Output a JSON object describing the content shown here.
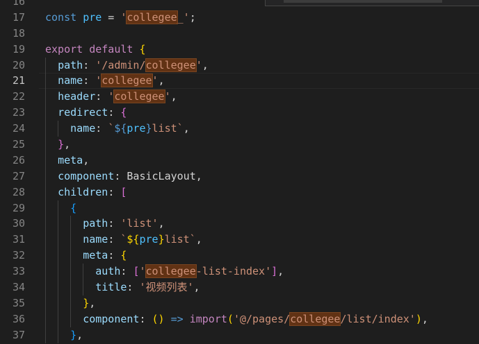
{
  "editor": {
    "lines": [
      {
        "num": "16",
        "indent": 0,
        "tokens": []
      },
      {
        "num": "17",
        "indent": 0,
        "tokens": [
          {
            "t": "const",
            "c": "kw"
          },
          {
            "t": " ",
            "c": "punc"
          },
          {
            "t": "pre",
            "c": "var"
          },
          {
            "t": " = ",
            "c": "punc"
          },
          {
            "t": "'",
            "c": "str"
          },
          {
            "t": "collegee",
            "c": "str",
            "hl": true
          },
          {
            "t": "_'",
            "c": "str"
          },
          {
            "t": ";",
            "c": "punc"
          }
        ]
      },
      {
        "num": "18",
        "indent": 0,
        "tokens": []
      },
      {
        "num": "19",
        "indent": 0,
        "tokens": [
          {
            "t": "export",
            "c": "ctl"
          },
          {
            "t": " ",
            "c": "punc"
          },
          {
            "t": "default",
            "c": "ctl"
          },
          {
            "t": " ",
            "c": "punc"
          },
          {
            "t": "{",
            "c": "b1"
          }
        ]
      },
      {
        "num": "20",
        "indent": 1,
        "tokens": [
          {
            "t": "  ",
            "c": "punc"
          },
          {
            "t": "path",
            "c": "prop"
          },
          {
            "t": ": ",
            "c": "punc"
          },
          {
            "t": "'/admin/",
            "c": "str"
          },
          {
            "t": "collegee",
            "c": "str",
            "hl": true
          },
          {
            "t": "'",
            "c": "str"
          },
          {
            "t": ",",
            "c": "punc"
          }
        ]
      },
      {
        "num": "21",
        "indent": 1,
        "current": true,
        "tokens": [
          {
            "t": "  ",
            "c": "punc"
          },
          {
            "t": "name",
            "c": "prop"
          },
          {
            "t": ": ",
            "c": "punc"
          },
          {
            "t": "'",
            "c": "str"
          },
          {
            "t": "collegee",
            "c": "str",
            "hl": true
          },
          {
            "t": "'",
            "c": "str"
          },
          {
            "t": ",",
            "c": "punc"
          }
        ]
      },
      {
        "num": "22",
        "indent": 1,
        "tokens": [
          {
            "t": "  ",
            "c": "punc"
          },
          {
            "t": "header",
            "c": "prop"
          },
          {
            "t": ": ",
            "c": "punc"
          },
          {
            "t": "'",
            "c": "str"
          },
          {
            "t": "collegee",
            "c": "str",
            "hl": true
          },
          {
            "t": "'",
            "c": "str"
          },
          {
            "t": ",",
            "c": "punc"
          }
        ]
      },
      {
        "num": "23",
        "indent": 1,
        "tokens": [
          {
            "t": "  ",
            "c": "punc"
          },
          {
            "t": "redirect",
            "c": "prop"
          },
          {
            "t": ": ",
            "c": "punc"
          },
          {
            "t": "{",
            "c": "b2"
          }
        ]
      },
      {
        "num": "24",
        "indent": 2,
        "tokens": [
          {
            "t": "    ",
            "c": "punc"
          },
          {
            "t": "name",
            "c": "prop"
          },
          {
            "t": ": ",
            "c": "punc"
          },
          {
            "t": "`",
            "c": "str"
          },
          {
            "t": "${",
            "c": "tpl"
          },
          {
            "t": "pre",
            "c": "var"
          },
          {
            "t": "}",
            "c": "tpl"
          },
          {
            "t": "list",
            "c": "str"
          },
          {
            "t": "`",
            "c": "str"
          },
          {
            "t": ",",
            "c": "punc"
          }
        ]
      },
      {
        "num": "25",
        "indent": 1,
        "tokens": [
          {
            "t": "  ",
            "c": "punc"
          },
          {
            "t": "}",
            "c": "b2"
          },
          {
            "t": ",",
            "c": "punc"
          }
        ]
      },
      {
        "num": "26",
        "indent": 1,
        "tokens": [
          {
            "t": "  ",
            "c": "punc"
          },
          {
            "t": "meta",
            "c": "prop"
          },
          {
            "t": ",",
            "c": "punc"
          }
        ]
      },
      {
        "num": "27",
        "indent": 1,
        "tokens": [
          {
            "t": "  ",
            "c": "punc"
          },
          {
            "t": "component",
            "c": "prop"
          },
          {
            "t": ": ",
            "c": "punc"
          },
          {
            "t": "BasicLayout",
            "c": "cls"
          },
          {
            "t": ",",
            "c": "punc"
          }
        ]
      },
      {
        "num": "28",
        "indent": 1,
        "tokens": [
          {
            "t": "  ",
            "c": "punc"
          },
          {
            "t": "children",
            "c": "prop"
          },
          {
            "t": ": ",
            "c": "punc"
          },
          {
            "t": "[",
            "c": "b2"
          }
        ]
      },
      {
        "num": "29",
        "indent": 2,
        "tokens": [
          {
            "t": "    ",
            "c": "punc"
          },
          {
            "t": "{",
            "c": "b3"
          }
        ]
      },
      {
        "num": "30",
        "indent": 3,
        "tokens": [
          {
            "t": "      ",
            "c": "punc"
          },
          {
            "t": "path",
            "c": "prop"
          },
          {
            "t": ": ",
            "c": "punc"
          },
          {
            "t": "'list'",
            "c": "str"
          },
          {
            "t": ",",
            "c": "punc"
          }
        ]
      },
      {
        "num": "31",
        "indent": 3,
        "tokens": [
          {
            "t": "      ",
            "c": "punc"
          },
          {
            "t": "name",
            "c": "prop"
          },
          {
            "t": ": ",
            "c": "punc"
          },
          {
            "t": "`",
            "c": "str"
          },
          {
            "t": "${",
            "c": "b1"
          },
          {
            "t": "pre",
            "c": "var"
          },
          {
            "t": "}",
            "c": "b1"
          },
          {
            "t": "list",
            "c": "str"
          },
          {
            "t": "`",
            "c": "str"
          },
          {
            "t": ",",
            "c": "punc"
          }
        ]
      },
      {
        "num": "32",
        "indent": 3,
        "tokens": [
          {
            "t": "      ",
            "c": "punc"
          },
          {
            "t": "meta",
            "c": "prop"
          },
          {
            "t": ": ",
            "c": "punc"
          },
          {
            "t": "{",
            "c": "b1"
          }
        ]
      },
      {
        "num": "33",
        "indent": 4,
        "tokens": [
          {
            "t": "        ",
            "c": "punc"
          },
          {
            "t": "auth",
            "c": "prop"
          },
          {
            "t": ": ",
            "c": "punc"
          },
          {
            "t": "[",
            "c": "b2"
          },
          {
            "t": "'",
            "c": "str"
          },
          {
            "t": "collegee",
            "c": "str",
            "hl": true
          },
          {
            "t": "-list-index'",
            "c": "str"
          },
          {
            "t": "]",
            "c": "b2"
          },
          {
            "t": ",",
            "c": "punc"
          }
        ]
      },
      {
        "num": "34",
        "indent": 4,
        "tokens": [
          {
            "t": "        ",
            "c": "punc"
          },
          {
            "t": "title",
            "c": "prop"
          },
          {
            "t": ": ",
            "c": "punc"
          },
          {
            "t": "'视频列表'",
            "c": "str"
          },
          {
            "t": ",",
            "c": "punc"
          }
        ]
      },
      {
        "num": "35",
        "indent": 3,
        "tokens": [
          {
            "t": "      ",
            "c": "punc"
          },
          {
            "t": "}",
            "c": "b1"
          },
          {
            "t": ",",
            "c": "punc"
          }
        ]
      },
      {
        "num": "36",
        "indent": 3,
        "tokens": [
          {
            "t": "      ",
            "c": "punc"
          },
          {
            "t": "component",
            "c": "prop"
          },
          {
            "t": ": ",
            "c": "punc"
          },
          {
            "t": "()",
            "c": "b1"
          },
          {
            "t": " ",
            "c": "punc"
          },
          {
            "t": "=>",
            "c": "kw"
          },
          {
            "t": " ",
            "c": "punc"
          },
          {
            "t": "import",
            "c": "ctl"
          },
          {
            "t": "(",
            "c": "b1"
          },
          {
            "t": "'@/pages/",
            "c": "str"
          },
          {
            "t": "collegee",
            "c": "str",
            "hl": true
          },
          {
            "t": "/list/index'",
            "c": "str"
          },
          {
            "t": ")",
            "c": "b1"
          },
          {
            "t": ",",
            "c": "punc"
          }
        ]
      },
      {
        "num": "37",
        "indent": 2,
        "tokens": [
          {
            "t": "    ",
            "c": "punc"
          },
          {
            "t": "}",
            "c": "b3"
          },
          {
            "t": ",",
            "c": "punc"
          }
        ]
      }
    ]
  },
  "colors": {
    "background": "#1e1e1e",
    "find_match_highlight": "#613214",
    "line_number": "#858585"
  }
}
